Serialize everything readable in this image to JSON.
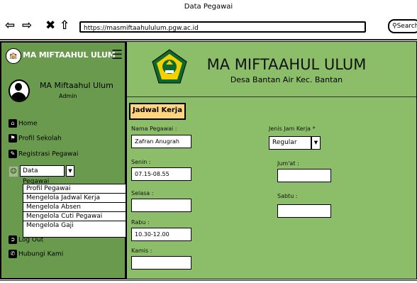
{
  "browser": {
    "title": "Data Pegawai",
    "url": "https://masmiftaahululum.pgw.ac.id",
    "search_label": "Search",
    "icons": [
      "arrow-left-icon",
      "arrow-right-icon",
      "close-icon",
      "home-icon",
      "search-icon"
    ]
  },
  "sidebar": {
    "brand": "MA MIFTAAHUL ULUM",
    "profile": {
      "name": "MA Miftaahul Ulum",
      "role": "Admin"
    },
    "items": [
      {
        "label": "Home",
        "icon": "home-icon"
      },
      {
        "label": "Profil Sekolah",
        "icon": "school-icon"
      },
      {
        "label": "Registrasi Pegawai",
        "icon": "edit-icon"
      },
      {
        "label": "Data Pegawai",
        "icon": "user-icon"
      },
      {
        "label": "Log Out",
        "icon": "logout-icon"
      },
      {
        "label": "Hubungi Kami",
        "icon": "phone-icon"
      }
    ],
    "dropdown_options": [
      "Profil Pegawai",
      "Mengelola Jadwal Kerja",
      "Mengelola Absen",
      "Mengelola Cuti Pegawai",
      "Mengelola Gaji"
    ]
  },
  "header": {
    "title": "MA MIFTAAHUL ULUM",
    "subtitle": "Desa Bantan Air Kec. Bantan"
  },
  "form": {
    "section_title": "Jadwal Kerja",
    "nama_label": "Nama Pegawai :",
    "nama_value": "Zafran Anugrah",
    "jenis_label": "Jenis Jam Kerja *",
    "jenis_value": "Regular",
    "senin_label": "Senin :",
    "senin_value": "07.15-08.55",
    "jumat_label": "Jum'at :",
    "jumat_value": "",
    "selasa_label": "Selasa :",
    "selasa_value": "",
    "sabtu_label": "Sabtu :",
    "sabtu_value": "",
    "rabu_label": "Rabu :",
    "rabu_value": "10.30-12.00",
    "kamis_label": "Kamis :",
    "kamis_value": ""
  },
  "colors": {
    "sidebar_bg": "#6a9a4e",
    "main_bg": "#8cbe6a",
    "section_title_bg": "#ffd580"
  }
}
